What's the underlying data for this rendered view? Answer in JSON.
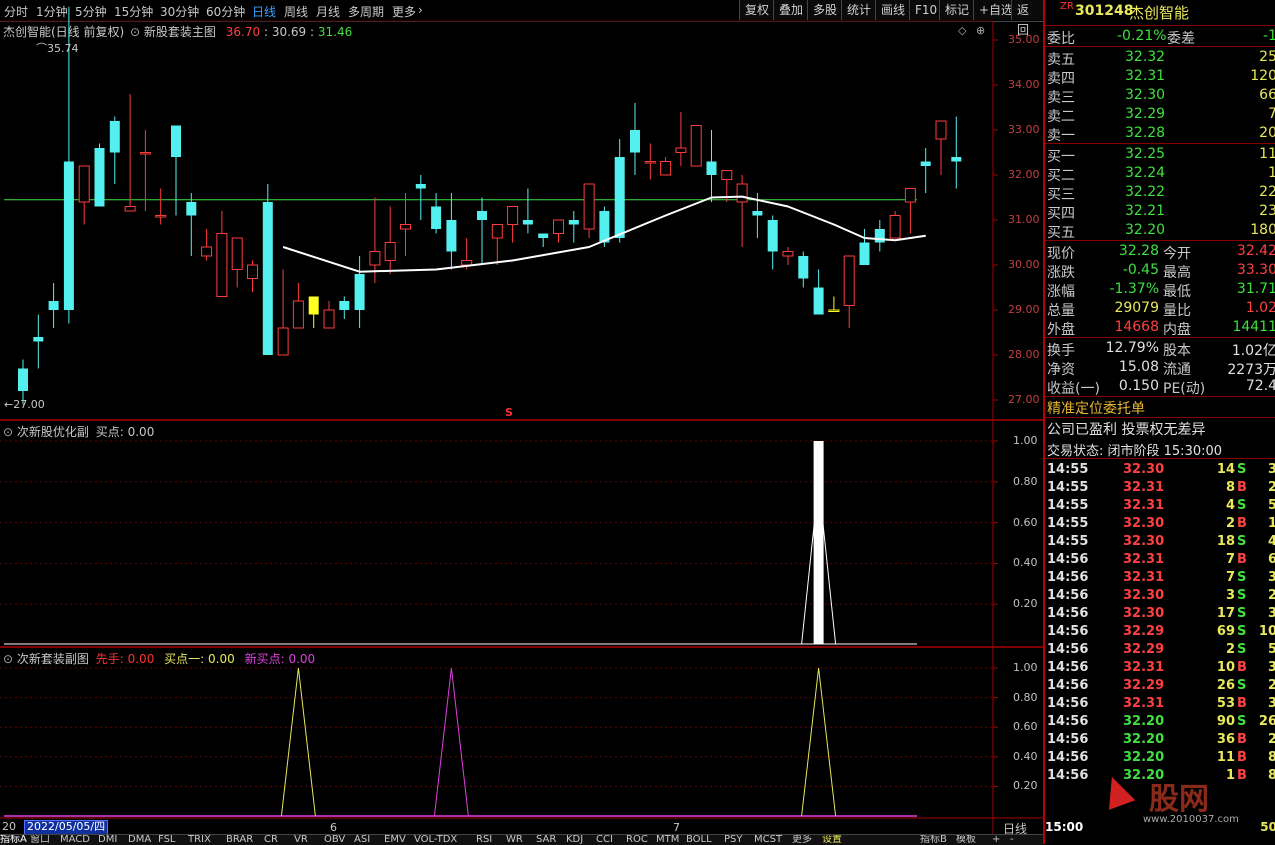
{
  "toolbar": {
    "periods": [
      "分时",
      "1分钟",
      "5分钟",
      "15分钟",
      "30分钟",
      "60分钟",
      "日线",
      "周线",
      "月线",
      "多周期",
      "更多"
    ],
    "active_period": "日线",
    "right_buttons": [
      "复权",
      "叠加",
      "多股",
      "统计",
      "画线",
      "F10",
      "标记",
      "+自选",
      "返回"
    ]
  },
  "main_chart": {
    "stock_label": "杰创智能(日线 前复权)",
    "indicator_name": "新股套装主图",
    "values": [
      "36.70",
      "30.69",
      "31.46"
    ],
    "high_marker": "35.74",
    "low_marker": "27.00",
    "s_marker": "S",
    "price_ticks": [
      "35.00",
      "34.00",
      "33.00",
      "32.00",
      "31.00",
      "30.00",
      "29.00",
      "28.00",
      "27.00"
    ]
  },
  "chart_data": {
    "type": "candlestick",
    "yrange": [
      26.6,
      36.2
    ],
    "flat_line": 31.45,
    "candles": [
      [
        27.7,
        27.9,
        26.9,
        27.2
      ],
      [
        28.4,
        28.9,
        27.7,
        28.3
      ],
      [
        29.2,
        29.6,
        28.6,
        29.0
      ],
      [
        32.3,
        35.74,
        28.7,
        29.0
      ],
      [
        31.4,
        32.0,
        30.9,
        32.2
      ],
      [
        32.6,
        32.7,
        31.6,
        31.3
      ],
      [
        33.2,
        33.3,
        31.8,
        32.5
      ],
      [
        31.2,
        33.8,
        31.2,
        31.3
      ],
      [
        32.5,
        33.0,
        31.2,
        32.5
      ],
      [
        31.1,
        31.7,
        30.9,
        31.1
      ],
      [
        33.1,
        33.1,
        31.1,
        32.4
      ],
      [
        31.4,
        31.6,
        30.2,
        31.1
      ],
      [
        30.2,
        30.8,
        30.1,
        30.4
      ],
      [
        29.3,
        31.2,
        29.3,
        30.7
      ],
      [
        29.9,
        30.3,
        29.5,
        30.6
      ],
      [
        29.7,
        30.1,
        29.4,
        30.0
      ],
      [
        31.4,
        31.8,
        28.1,
        28.0
      ],
      [
        28.0,
        29.9,
        28.0,
        28.6
      ],
      [
        28.6,
        29.6,
        28.7,
        29.2
      ],
      [
        28.9,
        29.0,
        28.6,
        29.3
      ],
      [
        28.6,
        29.2,
        28.7,
        29.0
      ],
      [
        29.2,
        29.3,
        28.8,
        29.0
      ],
      [
        29.8,
        30.2,
        28.6,
        29.0
      ],
      [
        30.0,
        31.5,
        29.6,
        30.3
      ],
      [
        30.1,
        31.3,
        29.8,
        30.5
      ],
      [
        30.8,
        31.6,
        30.2,
        30.9
      ],
      [
        31.8,
        32.0,
        31.0,
        31.7
      ],
      [
        31.3,
        31.6,
        30.7,
        30.8
      ],
      [
        31.0,
        31.6,
        29.9,
        30.3
      ],
      [
        30.0,
        30.6,
        29.9,
        30.1
      ],
      [
        31.2,
        31.5,
        30.0,
        31.0
      ],
      [
        30.6,
        30.7,
        30.0,
        30.9
      ],
      [
        30.9,
        31.2,
        30.5,
        31.3
      ],
      [
        31.0,
        31.7,
        30.7,
        30.9
      ],
      [
        30.7,
        30.7,
        30.4,
        30.6
      ],
      [
        30.7,
        31.0,
        30.5,
        31.0
      ],
      [
        31.0,
        31.2,
        30.5,
        30.9
      ],
      [
        30.8,
        31.8,
        30.6,
        31.8
      ],
      [
        31.2,
        31.3,
        30.4,
        30.5
      ],
      [
        32.4,
        32.8,
        30.5,
        30.6
      ],
      [
        33.0,
        33.6,
        32.0,
        32.5
      ],
      [
        32.3,
        32.7,
        31.9,
        32.3
      ],
      [
        32.0,
        32.4,
        32.5,
        32.3
      ],
      [
        32.5,
        33.4,
        32.2,
        32.6
      ],
      [
        32.2,
        33.0,
        32.2,
        33.1
      ],
      [
        32.3,
        33.0,
        31.4,
        32.0
      ],
      [
        31.9,
        32.1,
        31.4,
        32.1
      ],
      [
        31.4,
        32.0,
        30.4,
        31.8
      ],
      [
        31.2,
        31.6,
        30.6,
        31.1
      ],
      [
        31.0,
        31.1,
        29.9,
        30.3
      ],
      [
        30.2,
        30.4,
        30.0,
        30.3
      ],
      [
        30.2,
        30.3,
        29.5,
        29.7
      ],
      [
        29.5,
        29.9,
        28.9,
        28.9
      ],
      [
        29.0,
        29.3,
        29.0,
        29.0
      ],
      [
        29.1,
        30.0,
        28.6,
        30.2
      ],
      [
        30.5,
        30.8,
        30.1,
        30.0
      ],
      [
        30.8,
        31.0,
        30.3,
        30.5
      ],
      [
        30.6,
        31.2,
        30.7,
        31.1
      ],
      [
        31.4,
        31.6,
        30.7,
        31.7
      ],
      [
        32.3,
        32.6,
        31.6,
        32.2
      ],
      [
        32.8,
        33.2,
        32.0,
        33.2
      ],
      [
        32.4,
        33.3,
        31.7,
        32.3
      ]
    ],
    "curve": [
      [
        17,
        30.4
      ],
      [
        22,
        29.85
      ],
      [
        27,
        29.9
      ],
      [
        32,
        30.1
      ],
      [
        37,
        30.4
      ],
      [
        42,
        31.1
      ],
      [
        45,
        31.5
      ],
      [
        47,
        31.52
      ],
      [
        50,
        31.3
      ],
      [
        53,
        30.9
      ],
      [
        55,
        30.6
      ],
      [
        57,
        30.55
      ],
      [
        59,
        30.65
      ]
    ],
    "sub1": {
      "label": "次新股优化副",
      "value_label": "买点",
      "value": "0.00",
      "ticks": [
        "1.00",
        "0.80",
        "0.60",
        "0.40",
        "0.20"
      ],
      "spikes": [
        52
      ]
    },
    "sub2": {
      "label": "次新套装副图",
      "series": [
        {
          "name": "先手",
          "value": "0.00",
          "color": "#ff3030"
        },
        {
          "name": "买点一",
          "value": "0.00",
          "color": "#e8e85a"
        },
        {
          "name": "新买点",
          "value": "0.00",
          "color": "#e040e0"
        }
      ],
      "ticks": [
        "1.00",
        "0.80",
        "0.60",
        "0.40",
        "0.20"
      ],
      "spikes_yellow": [
        18,
        52
      ],
      "spikes_magenta": [
        28
      ]
    }
  },
  "side": {
    "prefix": "ZR",
    "code": "301248",
    "name": "杰创智能",
    "weibi_label": "委比",
    "weibi": "-0.21%",
    "weicha_label": "委差",
    "weicha": "-1",
    "sell": [
      {
        "label": "卖五",
        "price": "32.32",
        "vol": "25"
      },
      {
        "label": "卖四",
        "price": "32.31",
        "vol": "120"
      },
      {
        "label": "卖三",
        "price": "32.30",
        "vol": "66"
      },
      {
        "label": "卖二",
        "price": "32.29",
        "vol": "7"
      },
      {
        "label": "卖一",
        "price": "32.28",
        "vol": "20"
      }
    ],
    "buy": [
      {
        "label": "买一",
        "price": "32.25",
        "vol": "11"
      },
      {
        "label": "买二",
        "price": "32.24",
        "vol": "1"
      },
      {
        "label": "买三",
        "price": "32.22",
        "vol": "22"
      },
      {
        "label": "买四",
        "price": "32.21",
        "vol": "23"
      },
      {
        "label": "买五",
        "price": "32.20",
        "vol": "180"
      }
    ],
    "quote": [
      {
        "l1": "现价",
        "v1": "32.28",
        "c1": "#3fe03f",
        "l2": "今开",
        "v2": "32.42",
        "c2": "#ff4040"
      },
      {
        "l1": "涨跌",
        "v1": "-0.45",
        "c1": "#3fe03f",
        "l2": "最高",
        "v2": "33.30",
        "c2": "#ff4040"
      },
      {
        "l1": "涨幅",
        "v1": "-1.37%",
        "c1": "#3fe03f",
        "l2": "最低",
        "v2": "31.71",
        "c2": "#3fe03f"
      },
      {
        "l1": "总量",
        "v1": "29079",
        "c1": "#e8e85a",
        "l2": "量比",
        "v2": "1.02",
        "c2": "#ff4040"
      },
      {
        "l1": "外盘",
        "v1": "14668",
        "c1": "#ff4040",
        "l2": "内盘",
        "v2": "14411",
        "c2": "#3fe03f"
      }
    ],
    "info": [
      {
        "l1": "换手",
        "v1": "12.79%",
        "l2": "股本",
        "v2": "1.02亿"
      },
      {
        "l1": "净资",
        "v1": "15.08",
        "l2": "流通",
        "v2": "2273万"
      },
      {
        "l1": "收益(一)",
        "v1": "0.150",
        "l2": "PE(动)",
        "v2": "72.4"
      }
    ],
    "entrust": "精准定位委托单",
    "company": "公司已盈利 投票权无差异",
    "status": "交易状态: 闭市阶段 15:30:00",
    "ticks": [
      [
        "14:55",
        "32.30",
        "14",
        "S"
      ],
      [
        "14:55",
        "32.31",
        "8",
        "B"
      ],
      [
        "14:55",
        "32.31",
        "4",
        "S"
      ],
      [
        "14:55",
        "32.30",
        "2",
        "B"
      ],
      [
        "14:55",
        "32.30",
        "18",
        "S"
      ],
      [
        "14:56",
        "32.31",
        "7",
        "B"
      ],
      [
        "14:56",
        "32.31",
        "7",
        "S"
      ],
      [
        "14:56",
        "32.30",
        "3",
        "S"
      ],
      [
        "14:56",
        "32.30",
        "17",
        "S"
      ],
      [
        "14:56",
        "32.29",
        "69",
        "S"
      ],
      [
        "14:56",
        "32.29",
        "2",
        "S"
      ],
      [
        "14:56",
        "32.31",
        "10",
        "B"
      ],
      [
        "14:56",
        "32.29",
        "26",
        "S"
      ],
      [
        "14:56",
        "32.31",
        "53",
        "B"
      ],
      [
        "14:56",
        "32.20",
        "90",
        "S"
      ],
      [
        "14:56",
        "32.20",
        "36",
        "B"
      ],
      [
        "14:56",
        "32.20",
        "11",
        "B"
      ],
      [
        "14:56",
        "32.20",
        "1",
        "B"
      ]
    ],
    "tick_extra": [
      "3",
      "2",
      "5",
      "1",
      "4",
      "6",
      "3",
      "2",
      "3",
      "10",
      "5",
      "3",
      "2",
      "3",
      "26",
      "2",
      "8",
      "8"
    ]
  },
  "bottom": {
    "date_box": "2022/05/05/四",
    "year_prefix": "20",
    "month_marks": [
      "6",
      "7"
    ],
    "period_label": "日线",
    "tabs": [
      "指标A",
      "窗口",
      "MACD",
      "DMI",
      "DMA",
      "FSL",
      "TRIX",
      "BRAR",
      "CR",
      "VR",
      "OBV",
      "ASI",
      "EMV",
      "VOL-TDX",
      "RSI",
      "WR",
      "SAR",
      "KDJ",
      "CCI",
      "ROC",
      "MTM",
      "BOLL",
      "PSY",
      "MCST",
      "更多",
      "设置"
    ],
    "right_tabs": [
      "指标B",
      "模板",
      "+",
      "-"
    ]
  },
  "watermark": {
    "text": "股网",
    "url": "www.2010037.com",
    "last_time": "15:00",
    "last_vol": "50"
  }
}
